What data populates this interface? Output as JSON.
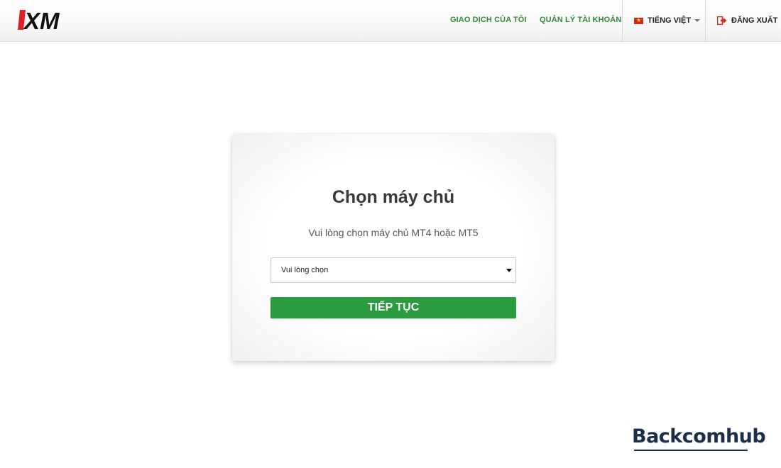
{
  "header": {
    "logo_text": "XM",
    "nav": [
      {
        "label": "GIAO DỊCH CỦA TÔI"
      },
      {
        "label": "QUẢN LÝ TÀI KHOẢN"
      }
    ],
    "language": {
      "label": "TIẾNG VIỆT",
      "flag_icon": "vietnam-flag-icon"
    },
    "logout": {
      "label": "ĐĂNG XUẤT",
      "icon": "logout-icon"
    }
  },
  "card": {
    "title": "Chọn máy chủ",
    "subtitle": "Vui lòng chọn máy chủ MT4 hoặc MT5",
    "select": {
      "selected": "Vui lòng chọn"
    },
    "button_label": "TIẾP TỤC"
  },
  "watermark": "Backcomhub",
  "colors": {
    "accent_green": "#2a9b3f",
    "nav_green": "#2e8b3a",
    "logo_red": "#e21f26",
    "logout_red": "#d9261c"
  }
}
